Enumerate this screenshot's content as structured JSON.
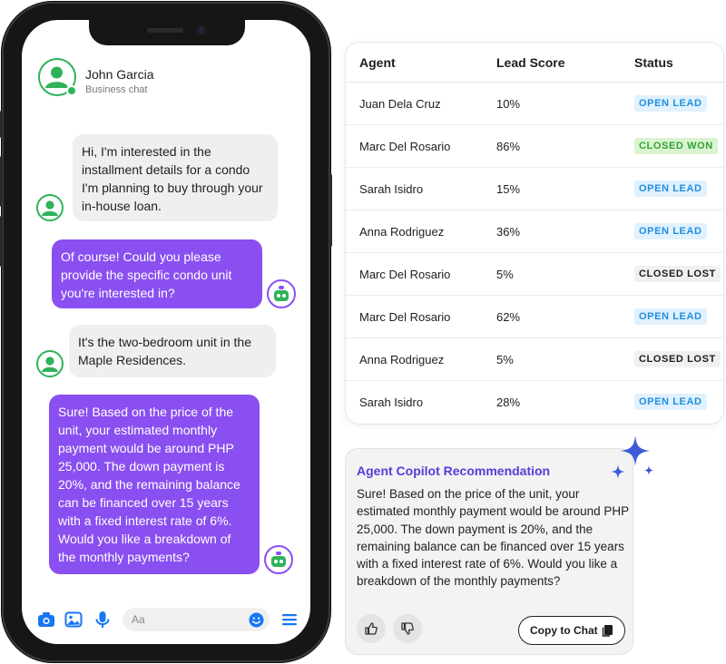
{
  "chat": {
    "contact_name": "John Garcia",
    "contact_subtitle": "Business chat",
    "messages": [
      {
        "from": "customer",
        "text": "Hi, I'm interested in the installment details for a condo I'm planning to buy through your in-house loan."
      },
      {
        "from": "agent",
        "text": "Of course! Could you please provide the specific condo unit you're interested in?"
      },
      {
        "from": "customer",
        "text": "It's the two-bedroom unit in the Maple Residences."
      },
      {
        "from": "agent",
        "text": "Sure! Based on the price of the unit, your estimated monthly payment would be around PHP 25,000. The down payment is 20%, and the remaining balance can be financed over 15 years with a fixed interest rate of 6%. Would you like a breakdown of the monthly payments?"
      }
    ],
    "composer": {
      "placeholder": "Aa",
      "icons": [
        "camera-icon",
        "image-icon",
        "microphone-icon",
        "emoji-icon",
        "menu-icon"
      ]
    }
  },
  "leads_table": {
    "columns": [
      "Agent",
      "Lead Score",
      "Status"
    ],
    "rows": [
      {
        "agent": "Juan Dela Cruz",
        "score": "10%",
        "status": "OPEN LEAD"
      },
      {
        "agent": "Marc Del Rosario",
        "score": "86%",
        "status": "CLOSED WON"
      },
      {
        "agent": "Sarah Isidro",
        "score": "15%",
        "status": "OPEN LEAD"
      },
      {
        "agent": "Anna Rodriguez",
        "score": "36%",
        "status": "OPEN LEAD"
      },
      {
        "agent": "Marc Del Rosario",
        "score": "5%",
        "status": "CLOSED LOST"
      },
      {
        "agent": "Marc Del Rosario",
        "score": "62%",
        "status": "OPEN LEAD"
      },
      {
        "agent": "Anna Rodriguez",
        "score": "5%",
        "status": "CLOSED LOST"
      },
      {
        "agent": "Sarah Isidro",
        "score": "28%",
        "status": "OPEN LEAD"
      }
    ]
  },
  "copilot": {
    "title": "Agent Copilot Recommendation",
    "body": "Sure! Based on the price of the unit, your estimated monthly payment would be around PHP 25,000. The down payment is 20%, and the remaining balance can be financed over 15 years with a fixed interest rate of 6%. Would you like a breakdown of the monthly payments?",
    "copy_label": "Copy to Chat"
  },
  "colors": {
    "brand_purple": "#8a4ff0",
    "copilot_title": "#5a3ad8",
    "online_green": "#2fb35a",
    "composer_blue": "#1877f2",
    "sparkle_blue": "#3f5bd8"
  }
}
